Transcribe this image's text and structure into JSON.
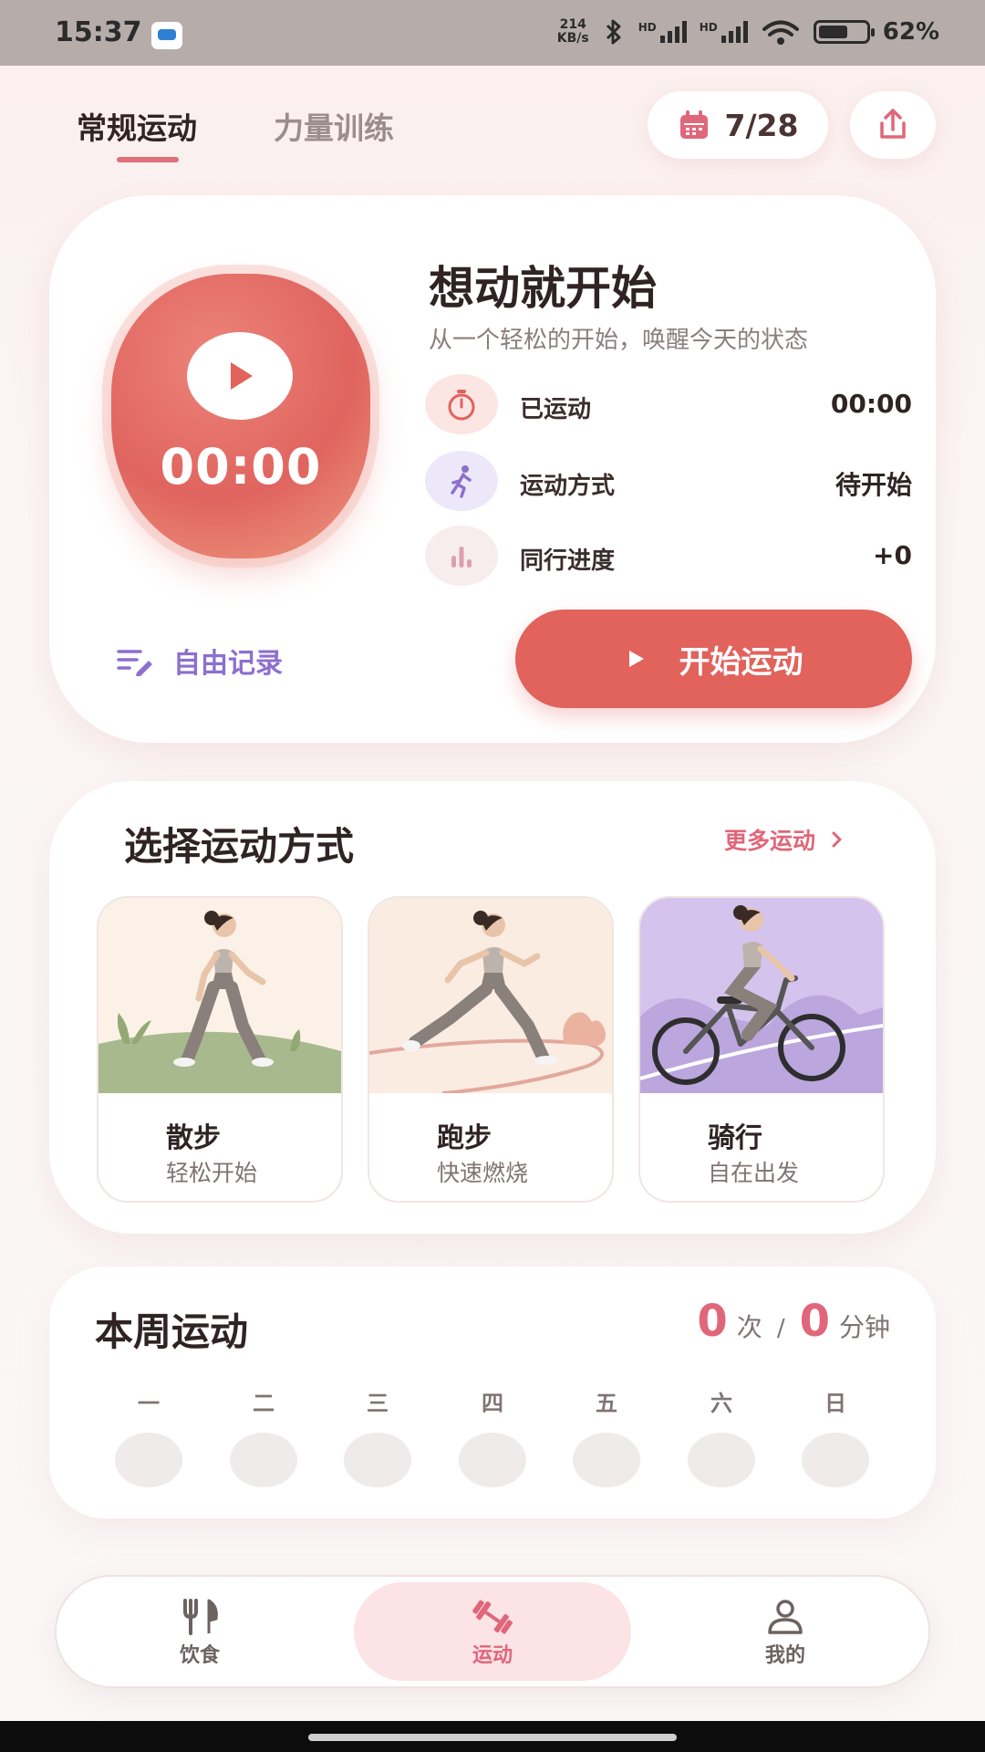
{
  "status_bar": {
    "time": "15:37",
    "speed_value": "214",
    "speed_unit": "KB/s",
    "network_1": "HD",
    "network_2": "HD",
    "battery": "62%",
    "battery_level": 0.62
  },
  "tabs": {
    "active": "常规运动",
    "inactive": "力量训练"
  },
  "date_pill": {
    "label": "7/28"
  },
  "hero": {
    "timer": "00:00",
    "title": "想动就开始",
    "subtitle": "从一个轻松的开始，唤醒今天的状态",
    "stats": [
      {
        "label": "已运动",
        "value": "00:00"
      },
      {
        "label": "运动方式",
        "value": "待开始"
      },
      {
        "label": "同行进度",
        "value": "+0"
      }
    ],
    "free_record": "自由记录",
    "start_button": "开始运动"
  },
  "exercise_section": {
    "title": "选择运动方式",
    "more_link": "更多运动",
    "items": [
      {
        "name": "散步",
        "desc": "轻松开始"
      },
      {
        "name": "跑步",
        "desc": "快速燃烧"
      },
      {
        "name": "骑行",
        "desc": "自在出发"
      }
    ]
  },
  "weekly": {
    "title": "本周运动",
    "count": "0",
    "count_unit": "次",
    "separator": "/",
    "minutes": "0",
    "minutes_unit": "分钟",
    "days": [
      "一",
      "二",
      "三",
      "四",
      "五",
      "六",
      "日"
    ]
  },
  "bottom_nav": {
    "items": [
      {
        "label": "饮食"
      },
      {
        "label": "运动"
      },
      {
        "label": "我的"
      }
    ]
  },
  "colors": {
    "accent": "#e2625c",
    "pink": "#e0667a",
    "purple": "#8d6fcf"
  }
}
